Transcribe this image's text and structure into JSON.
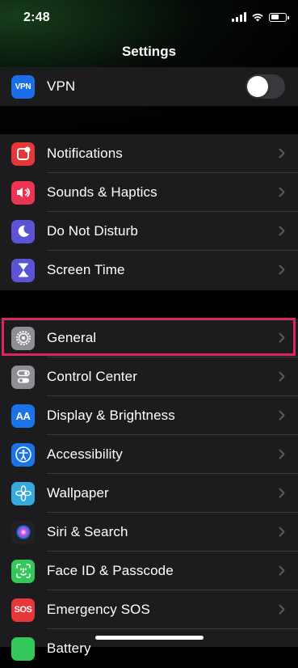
{
  "status_bar": {
    "time": "2:48"
  },
  "nav": {
    "title": "Settings"
  },
  "top_section": {
    "vpn": {
      "icon_text": "VPN",
      "label": "VPN",
      "toggle_on": false,
      "icon_color": "#1a6fe8"
    }
  },
  "section1": [
    {
      "label": "Notifications",
      "icon": "notifications-icon",
      "color": "#e5363a"
    },
    {
      "label": "Sounds & Haptics",
      "icon": "speaker-icon",
      "color": "#eb3451"
    },
    {
      "label": "Do Not Disturb",
      "icon": "moon-icon",
      "color": "#5b55d6"
    },
    {
      "label": "Screen Time",
      "icon": "hourglass-icon",
      "color": "#5b55d6"
    }
  ],
  "section2": [
    {
      "label": "General",
      "icon": "gear-icon",
      "color": "#8e8e93"
    },
    {
      "label": "Control Center",
      "icon": "toggles-icon",
      "color": "#8e8e93"
    },
    {
      "label": "Display & Brightness",
      "icon": "display-icon",
      "icon_text": "AA",
      "color": "#1a73e8"
    },
    {
      "label": "Accessibility",
      "icon": "accessibility-icon",
      "color": "#1a73e8"
    },
    {
      "label": "Wallpaper",
      "icon": "flower-icon",
      "color": "#36aadc"
    },
    {
      "label": "Siri & Search",
      "icon": "siri-icon",
      "color": "#222"
    },
    {
      "label": "Face ID & Passcode",
      "icon": "faceid-icon",
      "color": "#34c759"
    },
    {
      "label": "Emergency SOS",
      "icon": "sos-icon",
      "icon_text": "SOS",
      "color": "#e5363a"
    },
    {
      "label": "Battery",
      "icon": "battery-icon",
      "color": "#34c759"
    }
  ],
  "colors": {
    "highlight": "#e0245e",
    "row_bg": "#1c1c1e",
    "divider": "#38383a"
  }
}
